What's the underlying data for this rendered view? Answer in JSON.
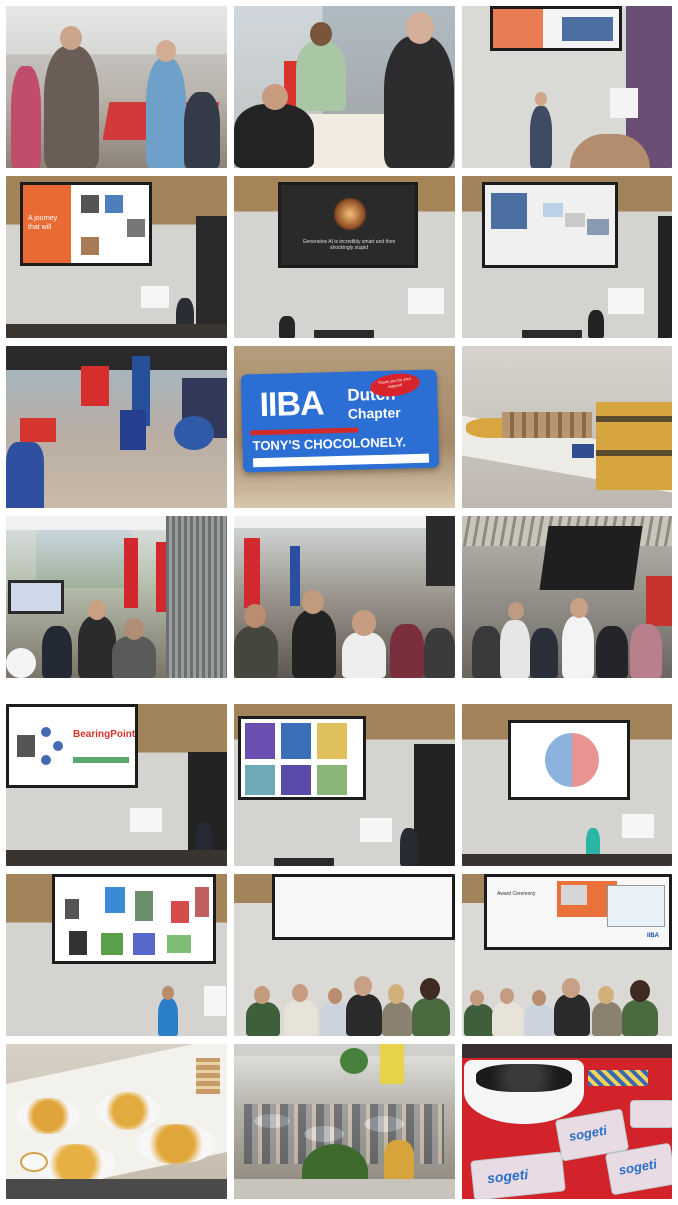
{
  "collage": {
    "rows": 7,
    "columns": 3
  },
  "tiles": [
    {
      "name": "photo-networking-crowd",
      "kind": "crowd"
    },
    {
      "name": "photo-registration-desk",
      "kind": "desk"
    },
    {
      "name": "photo-speaker-stage-1",
      "kind": "stage"
    },
    {
      "name": "photo-slide-journey",
      "kind": "slide",
      "slide_text": "A journey\nthat will",
      "bg": "#e86a33"
    },
    {
      "name": "photo-slide-lightbulb",
      "kind": "slide",
      "slide_text": "Generative AI is incredibly smart and then shockingly stupid",
      "bg": "#2a2a2a"
    },
    {
      "name": "photo-slide-video-call",
      "kind": "slide",
      "slide_text": "",
      "bg": "#f0f0f0"
    },
    {
      "name": "photo-venue-lobby",
      "kind": "lobby"
    },
    {
      "name": "photo-chocolate-bar",
      "kind": "chocolate"
    },
    {
      "name": "photo-chocolate-table",
      "kind": "table"
    },
    {
      "name": "photo-atrium-crowd",
      "kind": "crowd"
    },
    {
      "name": "photo-attendees-chatting",
      "kind": "crowd"
    },
    {
      "name": "photo-hall-crowd",
      "kind": "crowd"
    },
    {
      "name": "photo-slide-bearingpoint",
      "kind": "slide",
      "slide_text": "BearingPoint.",
      "bg": "#ffffff"
    },
    {
      "name": "photo-slide-images",
      "kind": "slide",
      "slide_text": "",
      "bg": "#ffffff"
    },
    {
      "name": "photo-slide-radar",
      "kind": "slide",
      "slide_text": "",
      "bg": "#ffffff"
    },
    {
      "name": "photo-slide-products",
      "kind": "slide",
      "slide_text": "",
      "bg": "#ffffff"
    },
    {
      "name": "photo-group-photo-1",
      "kind": "group"
    },
    {
      "name": "photo-group-photo-2",
      "kind": "group"
    },
    {
      "name": "photo-snacks-table",
      "kind": "snacks"
    },
    {
      "name": "photo-cafe-overview",
      "kind": "cafe"
    },
    {
      "name": "photo-candy-table",
      "kind": "candy"
    }
  ],
  "chocolate": {
    "brand": "IIBA",
    "sub": "Dutch",
    "sub2": "Chapter",
    "maker": "TONY'S CHOCOLONELY.",
    "badge": "Thank you for your support!"
  },
  "group_slide_title": "Award Ceremony",
  "group_slide_logo": "IIBA",
  "candy_brand": "sogeti",
  "colors": {
    "stage_wall": "#c9c9c6",
    "wood": "#9c7a4e",
    "chocolate_blue": "#2b6ed4",
    "candy_red": "#d2232b"
  }
}
